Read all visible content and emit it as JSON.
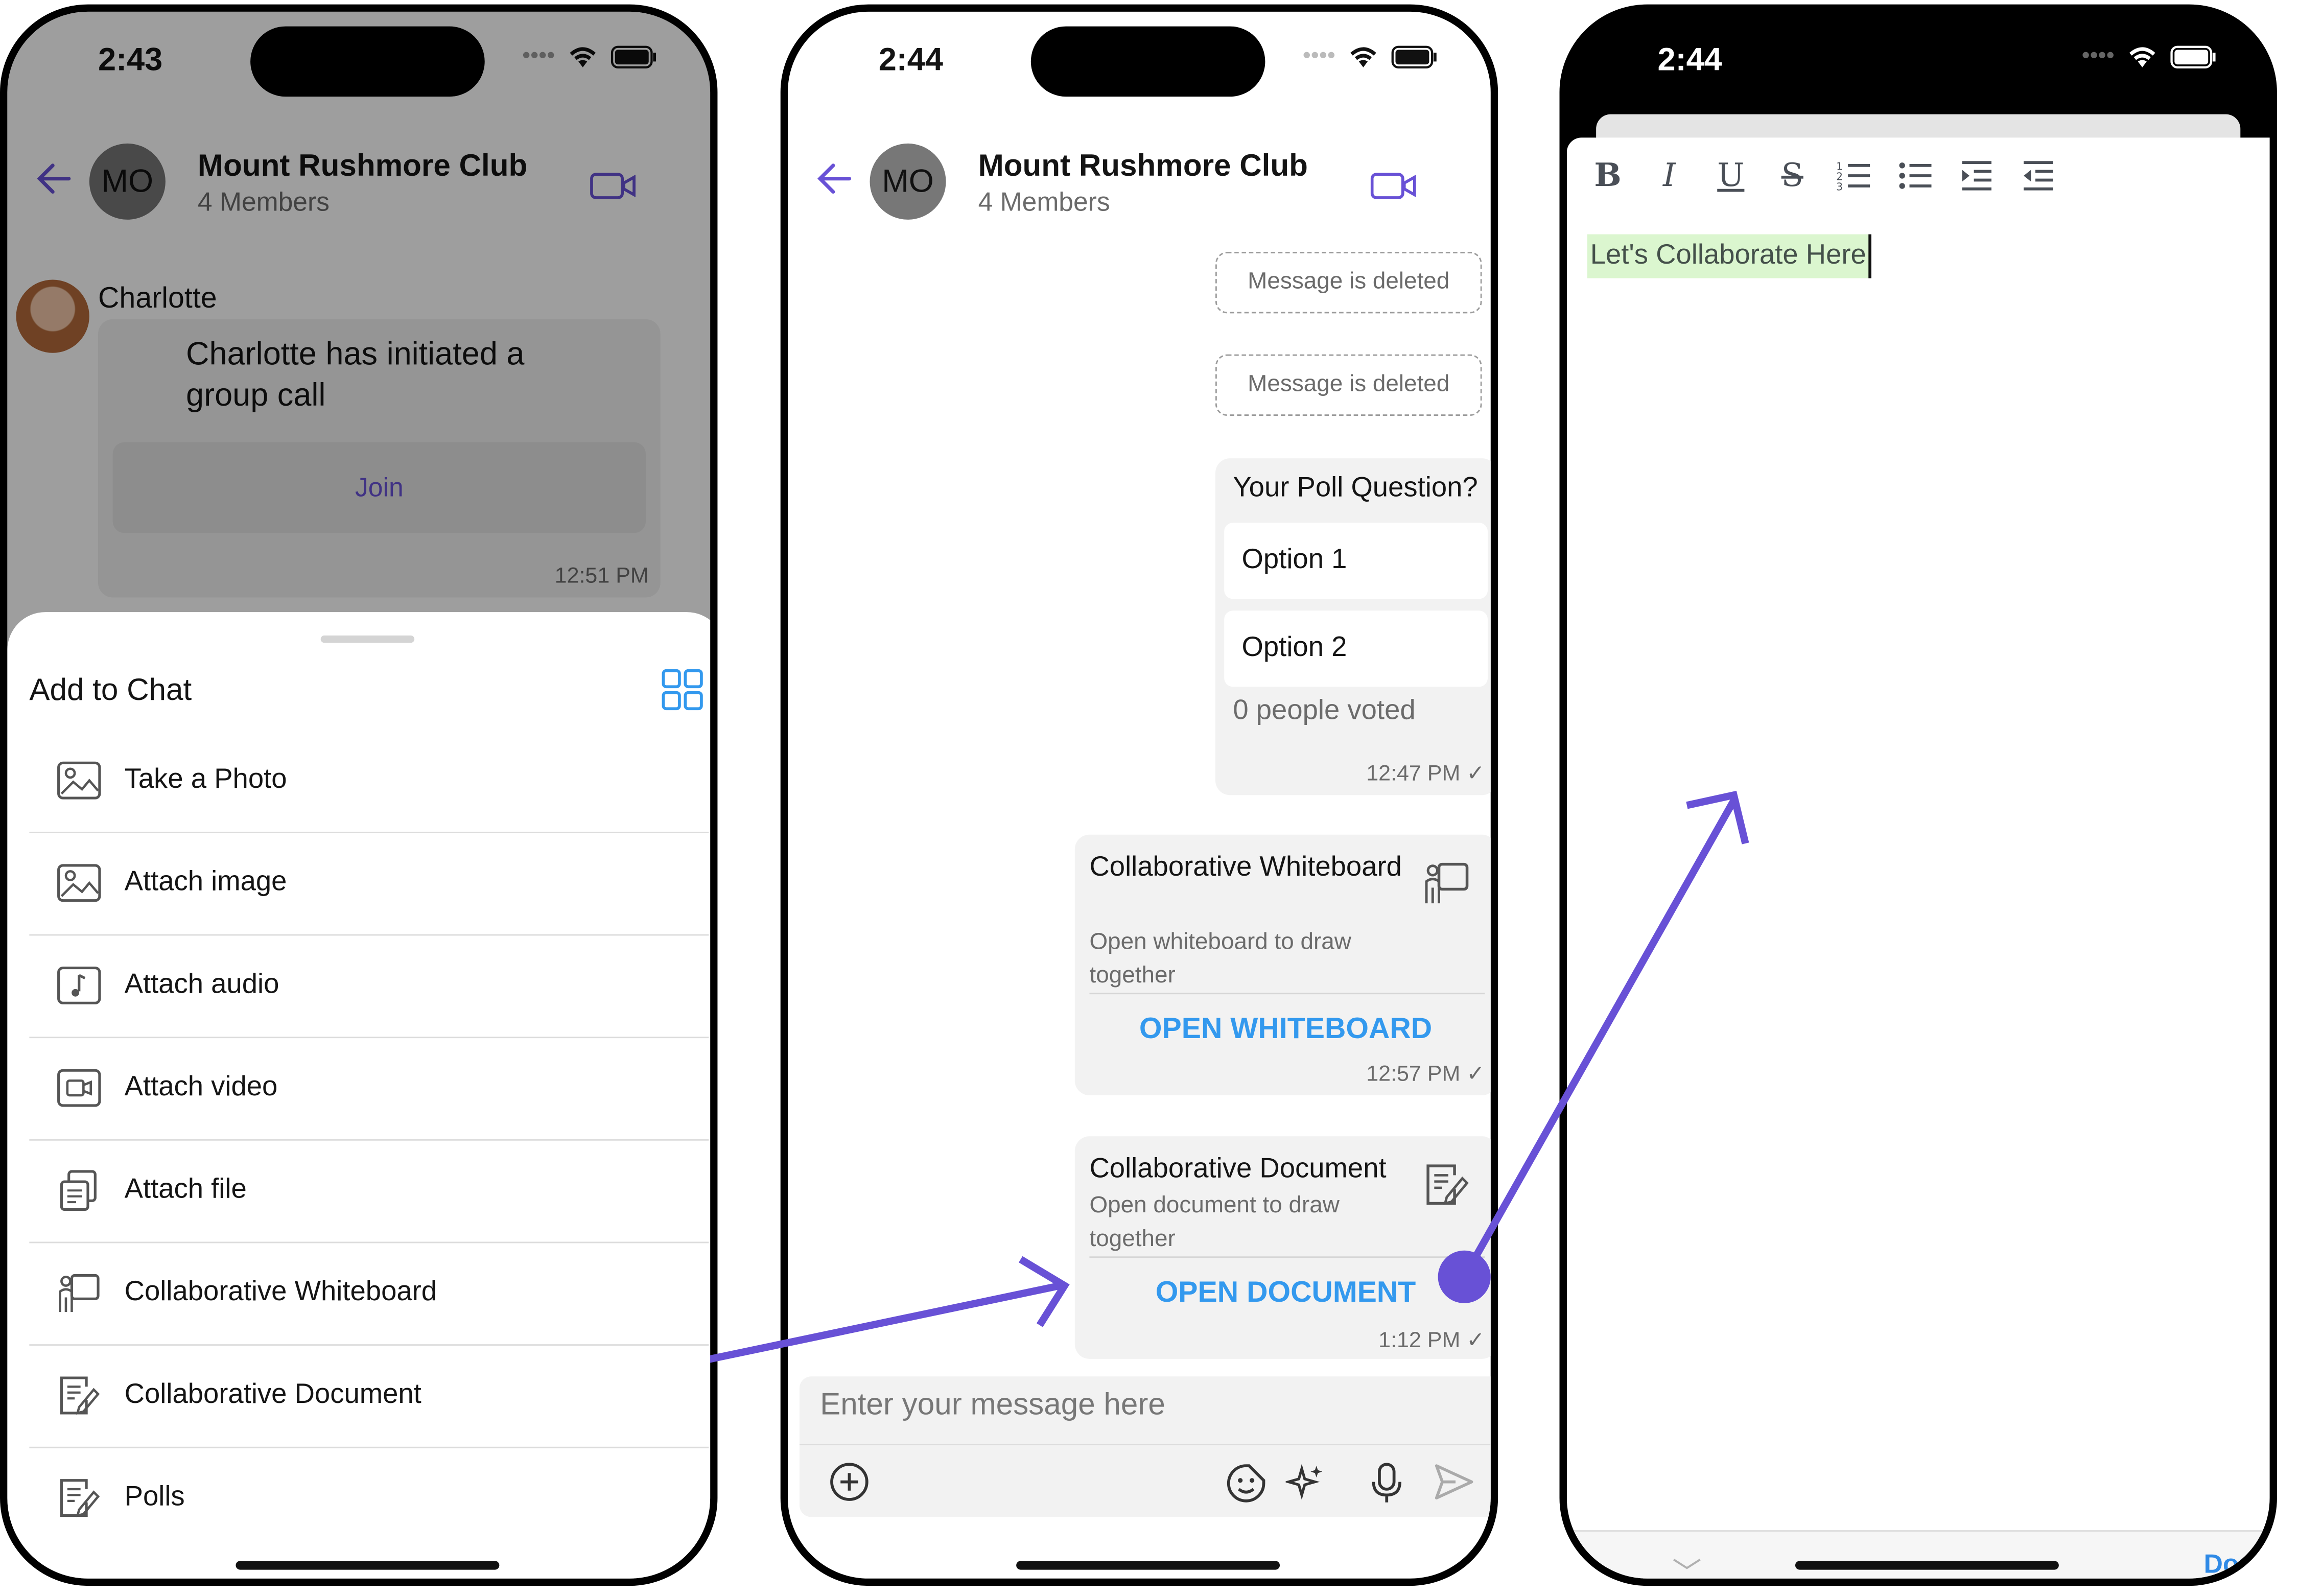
{
  "phone1": {
    "time": "2:43",
    "header": {
      "avatar_initials": "MO",
      "title": "Mount Rushmore Club",
      "subtitle": "4 Members"
    },
    "message": {
      "sender": "Charlotte",
      "text": "Charlotte has initiated a group call",
      "join_label": "Join",
      "time": "12:51 PM"
    },
    "sheet": {
      "title": "Add to Chat",
      "options": [
        {
          "label": "Take a Photo",
          "icon": "image-icon"
        },
        {
          "label": "Attach image",
          "icon": "image-icon"
        },
        {
          "label": "Attach audio",
          "icon": "audio-icon"
        },
        {
          "label": "Attach video",
          "icon": "video-icon"
        },
        {
          "label": "Attach file",
          "icon": "file-icon"
        },
        {
          "label": "Collaborative Whiteboard",
          "icon": "whiteboard-icon"
        },
        {
          "label": "Collaborative Document",
          "icon": "document-icon"
        },
        {
          "label": "Polls",
          "icon": "polls-icon"
        }
      ]
    }
  },
  "phone2": {
    "time": "2:44",
    "header": {
      "avatar_initials": "MO",
      "title": "Mount Rushmore Club",
      "subtitle": "4 Members"
    },
    "deleted_label": "Message is deleted",
    "poll": {
      "question": "Your Poll Question?",
      "options": [
        "Option 1",
        "Option 2"
      ],
      "votes": "0 people voted",
      "time": "12:47 PM"
    },
    "whiteboard": {
      "title": "Collaborative Whiteboard",
      "desc": "Open whiteboard to draw together",
      "button": "OPEN WHITEBOARD",
      "time": "12:57 PM"
    },
    "document": {
      "title": "Collaborative Document",
      "desc": "Open document to draw together",
      "button": "OPEN DOCUMENT",
      "time": "1:12 PM"
    },
    "composer": {
      "placeholder": "Enter your message here"
    }
  },
  "phone3": {
    "time": "2:44",
    "toolbar": [
      "B",
      "I",
      "U",
      "S"
    ],
    "doc_text": "Let's Collaborate Here",
    "kb_done": "Done"
  },
  "colors": {
    "accent": "#6851d6",
    "link_blue": "#3399ee",
    "highlight": "#dbf6cf"
  }
}
